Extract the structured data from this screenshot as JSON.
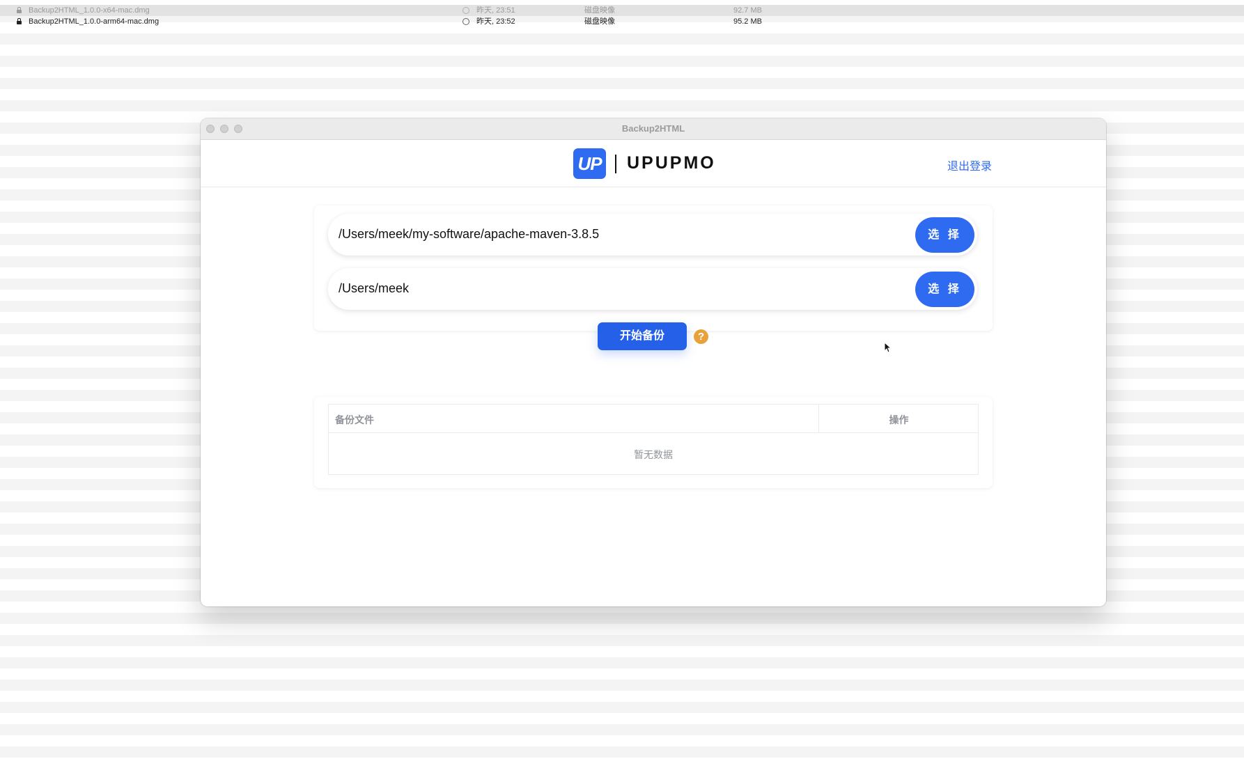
{
  "finder": {
    "files": [
      {
        "name": "Backup2HTML_1.0.0-x64-mac.dmg",
        "date": "昨天, 23:51",
        "kind": "磁盘映像",
        "size": "92.7 MB"
      },
      {
        "name": "Backup2HTML_1.0.0-arm64-mac.dmg",
        "date": "昨天, 23:52",
        "kind": "磁盘映像",
        "size": "95.2 MB"
      }
    ]
  },
  "window": {
    "title": "Backup2HTML"
  },
  "header": {
    "logo_mark": "UP",
    "logo_text": "UPUPMO",
    "logout_label": "退出登录"
  },
  "form": {
    "source_path": "/Users/meek/my-software/apache-maven-3.8.5",
    "target_path": "/Users/meek",
    "choose_label": "选 择",
    "start_label": "开始备份",
    "help_symbol": "?"
  },
  "table": {
    "col_file": "备份文件",
    "col_action": "操作",
    "empty_text": "暂无数据"
  },
  "colors": {
    "accent": "#2f6bf0",
    "help": "#e9a23b"
  }
}
